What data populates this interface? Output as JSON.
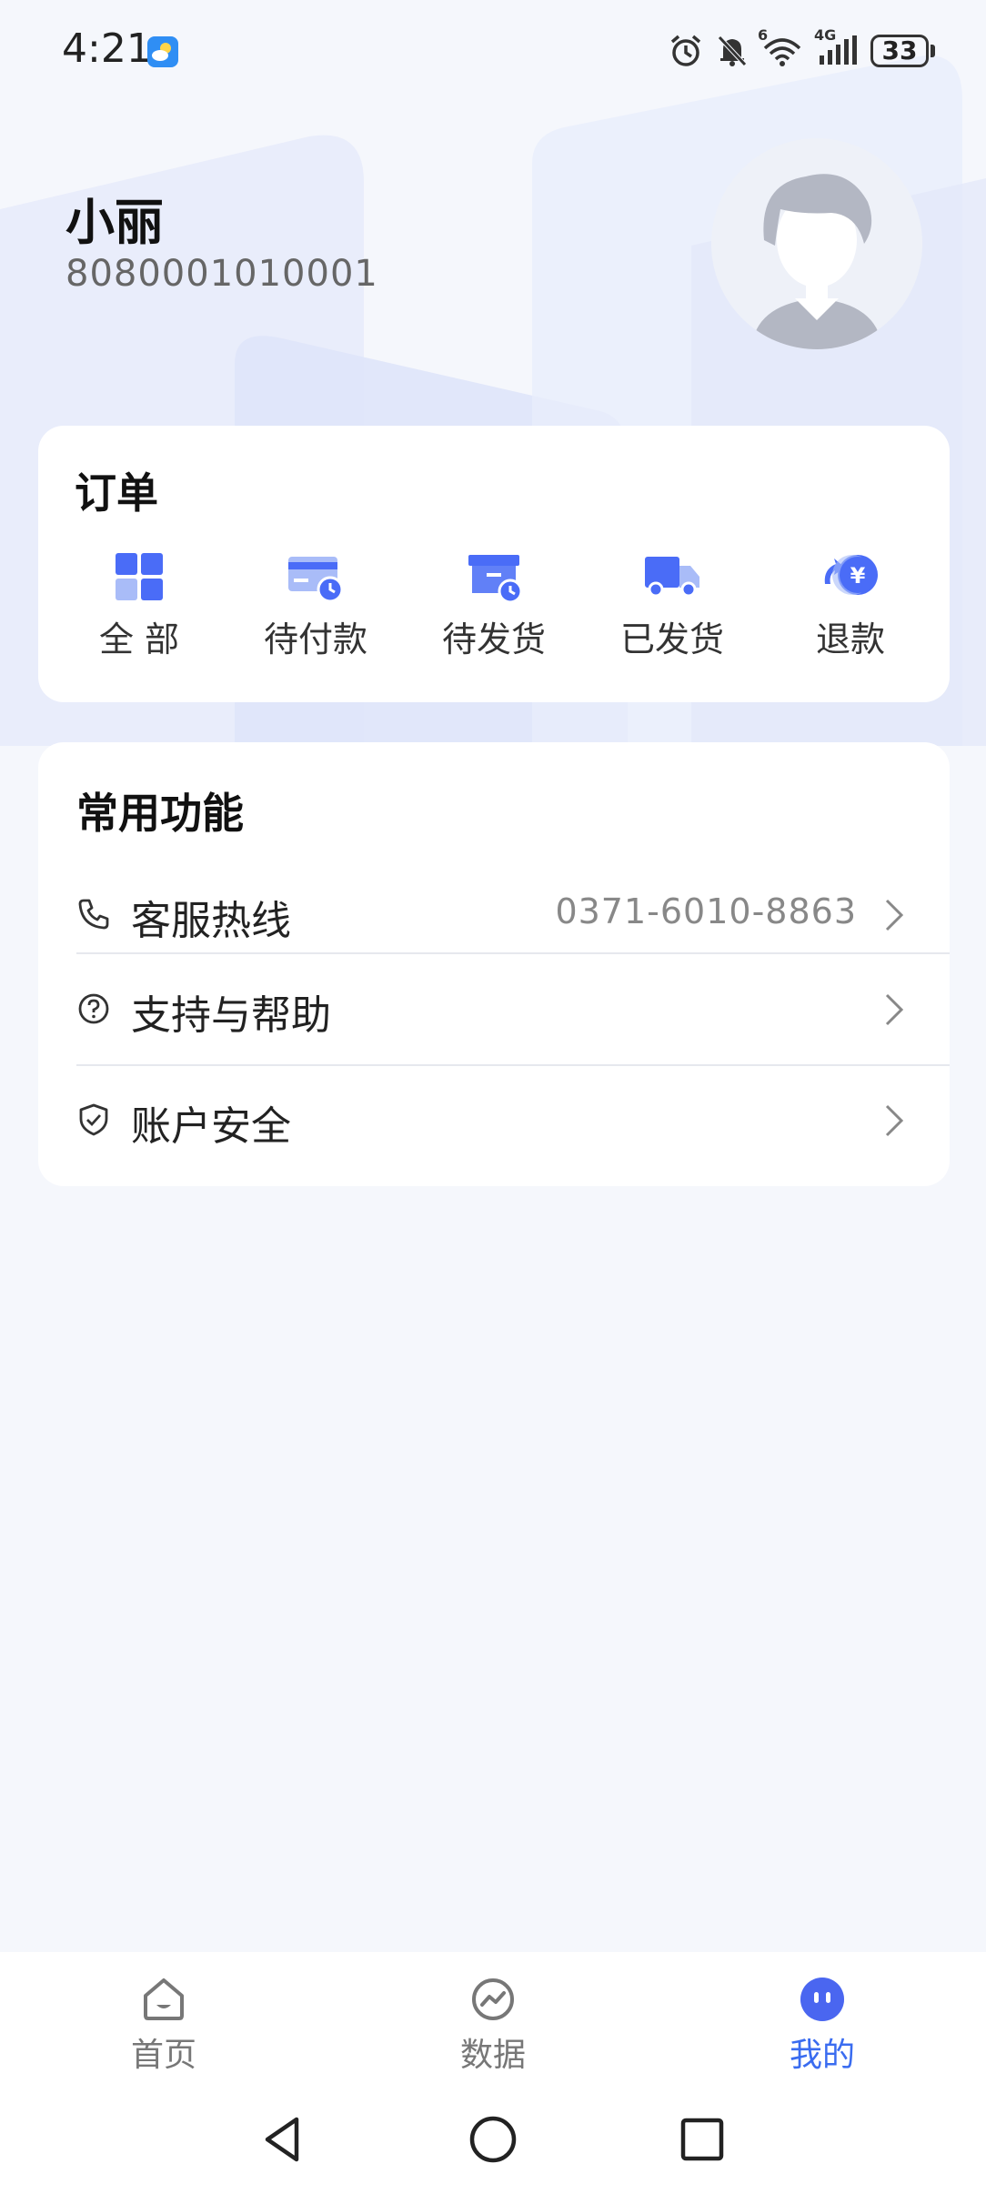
{
  "status_bar": {
    "time": "4:21",
    "wifi_badge": "6",
    "network": "4G",
    "battery": "33",
    "icons": [
      "weather-icon",
      "alarm-icon",
      "bell-mute-icon",
      "wifi-icon",
      "signal-icon",
      "battery-icon"
    ]
  },
  "profile": {
    "name": "小丽",
    "id": "8080001010001"
  },
  "orders": {
    "title": "订单",
    "items": [
      {
        "label": "全 部",
        "icon": "grid-icon"
      },
      {
        "label": "待付款",
        "icon": "card-clock-icon"
      },
      {
        "label": "待发货",
        "icon": "box-clock-icon"
      },
      {
        "label": "已发货",
        "icon": "truck-icon"
      },
      {
        "label": "退款",
        "icon": "refund-yen-icon"
      }
    ]
  },
  "functions": {
    "title": "常用功能",
    "rows": [
      {
        "label": "客服热线",
        "value": "0371-6010-8863",
        "icon": "phone-icon"
      },
      {
        "label": "支持与帮助",
        "value": "",
        "icon": "help-icon"
      },
      {
        "label": "账户安全",
        "value": "",
        "icon": "shield-icon"
      }
    ]
  },
  "tabbar": {
    "tabs": [
      {
        "label": "首页",
        "icon": "home-icon"
      },
      {
        "label": "数据",
        "icon": "chart-icon"
      },
      {
        "label": "我的",
        "icon": "profile-face-icon",
        "active": true
      }
    ]
  },
  "colors": {
    "accent": "#3a6cf0",
    "icon_blue": "#4a6cf7",
    "icon_light_blue": "#a9bcf8",
    "background": "#f5f7fc"
  }
}
